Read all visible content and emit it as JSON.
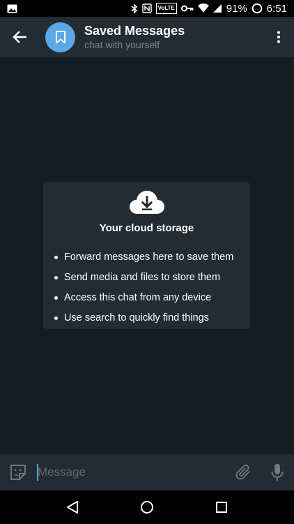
{
  "status_bar": {
    "battery_percent": "91%",
    "time": "6:51",
    "volte_label": "VoLTE"
  },
  "header": {
    "title": "Saved Messages",
    "subtitle": "chat with yourself"
  },
  "empty_state": {
    "title": "Your cloud storage",
    "items": [
      "Forward messages here to save them",
      "Send media and files to store them",
      "Access this chat from any device",
      "Use search to quickly find things"
    ]
  },
  "composer": {
    "placeholder": "Message"
  },
  "colors": {
    "header_bg": "#232b33",
    "chat_bg": "#171c20",
    "accent": "#5aa9e6",
    "subtitle": "#7c8893"
  },
  "icons": {
    "back": "arrow-left-icon",
    "avatar": "bookmark-icon",
    "menu": "kebab-menu-icon",
    "cloud": "cloud-download-icon",
    "emoji": "sticker-icon",
    "attach": "paperclip-icon",
    "mic": "microphone-icon",
    "nav_back": "triangle-back-icon",
    "nav_home": "circle-home-icon",
    "nav_recents": "square-recents-icon"
  }
}
